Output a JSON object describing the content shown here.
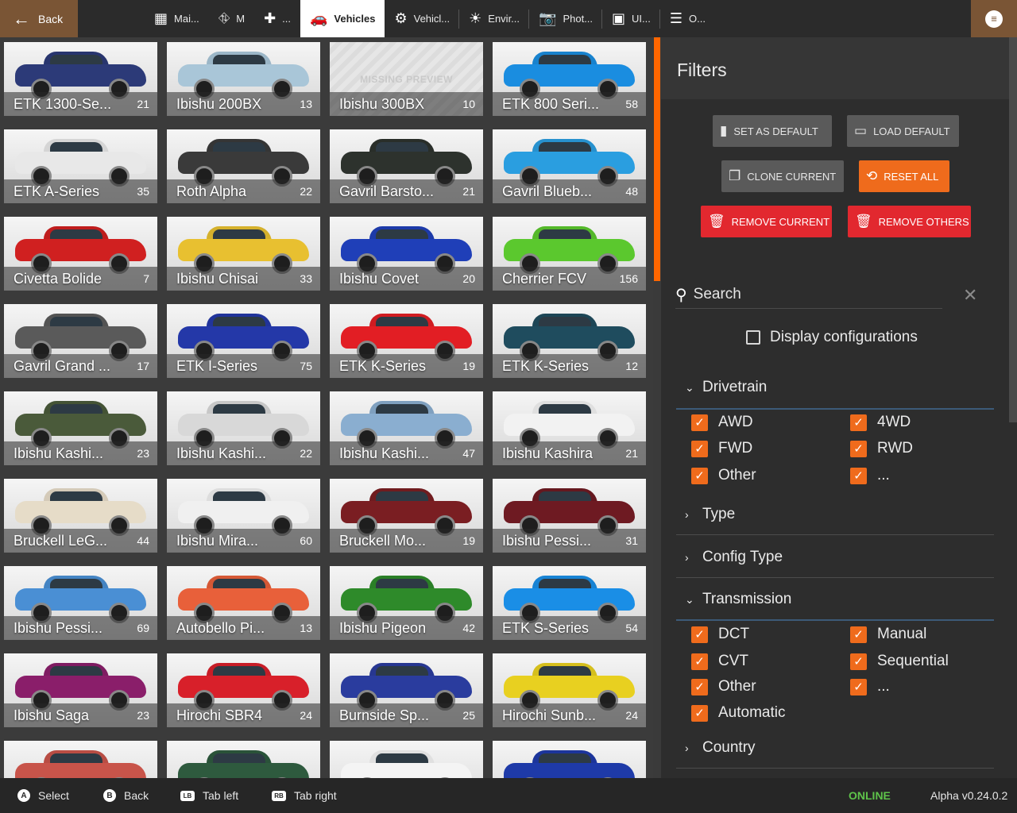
{
  "topbar": {
    "back_label": "Back",
    "tabs": [
      {
        "label": "Mai...",
        "icon": "main-menu-icon",
        "glyph": "▦"
      },
      {
        "label": "M",
        "icon": "map-icon",
        "glyph": "⛗"
      },
      {
        "label": "...",
        "icon": "puzzle-icon",
        "glyph": "✚"
      },
      {
        "label": "Vehicles",
        "icon": "car-icon",
        "glyph": "🚗"
      },
      {
        "label": "Vehicl...",
        "icon": "vehicle-config-icon",
        "glyph": "⚙"
      },
      {
        "label": "Envir...",
        "icon": "weather-icon",
        "glyph": "☀"
      },
      {
        "label": "Phot...",
        "icon": "camera-icon",
        "glyph": "📷"
      },
      {
        "label": "UI...",
        "icon": "ui-apps-icon",
        "glyph": "▣"
      },
      {
        "label": "O...",
        "icon": "sliders-icon",
        "glyph": "☰"
      }
    ]
  },
  "vehicles": [
    {
      "name": "ETK 1300-Se...",
      "count": "21",
      "color": "#2c3a78"
    },
    {
      "name": "Ibishu 200BX",
      "count": "13",
      "color": "#a9c6d8"
    },
    {
      "name": "Ibishu 300BX",
      "count": "10",
      "color": "",
      "missing": "MISSING PREVIEW"
    },
    {
      "name": "ETK 800 Seri...",
      "count": "58",
      "color": "#1a8de0"
    },
    {
      "name": "ETK A-Series",
      "count": "35",
      "color": "#e8e8e8"
    },
    {
      "name": "Roth Alpha",
      "count": "22",
      "color": "#3a3a3a"
    },
    {
      "name": "Gavril Barsto...",
      "count": "21",
      "color": "#2d322d"
    },
    {
      "name": "Gavril Blueb...",
      "count": "48",
      "color": "#2a9ee0"
    },
    {
      "name": "Civetta Bolide",
      "count": "7",
      "color": "#d02020"
    },
    {
      "name": "Ibishu Chisai",
      "count": "33",
      "color": "#e8c030"
    },
    {
      "name": "Ibishu Covet",
      "count": "20",
      "color": "#1f3fb8"
    },
    {
      "name": "Cherrier FCV",
      "count": "156",
      "color": "#5bc82e"
    },
    {
      "name": "Gavril Grand ...",
      "count": "17",
      "color": "#5a5a5a"
    },
    {
      "name": "ETK I-Series",
      "count": "75",
      "color": "#2438a8"
    },
    {
      "name": "ETK K-Series",
      "count": "19",
      "color": "#e21e24"
    },
    {
      "name": "ETK K-Series",
      "count": "12",
      "color": "#1f4c5e"
    },
    {
      "name": "Ibishu Kashi...",
      "count": "23",
      "color": "#4a5a3a"
    },
    {
      "name": "Ibishu Kashi...",
      "count": "22",
      "color": "#d8d8d8"
    },
    {
      "name": "Ibishu Kashi...",
      "count": "47",
      "color": "#8aaed0"
    },
    {
      "name": "Ibishu Kashira",
      "count": "21",
      "color": "#f2f2f2"
    },
    {
      "name": "Bruckell LeG...",
      "count": "44",
      "color": "#e6dcc8"
    },
    {
      "name": "Ibishu Mira...",
      "count": "60",
      "color": "#f0f0f0"
    },
    {
      "name": "Bruckell Mo...",
      "count": "19",
      "color": "#7a1e22"
    },
    {
      "name": "Ibishu Pessi...",
      "count": "31",
      "color": "#6e1a22"
    },
    {
      "name": "Ibishu Pessi...",
      "count": "69",
      "color": "#4a8fd4"
    },
    {
      "name": "Autobello Pi...",
      "count": "13",
      "color": "#e8603a"
    },
    {
      "name": "Ibishu Pigeon",
      "count": "42",
      "color": "#2e8a2a"
    },
    {
      "name": "ETK S-Series",
      "count": "54",
      "color": "#1a8ee6"
    },
    {
      "name": "Ibishu Saga",
      "count": "23",
      "color": "#8a1e6a"
    },
    {
      "name": "Hirochi SBR4",
      "count": "24",
      "color": "#d8202a"
    },
    {
      "name": "Burnside Sp...",
      "count": "25",
      "color": "#2a3c9e"
    },
    {
      "name": "Hirochi Sunb...",
      "count": "24",
      "color": "#e8d020"
    },
    {
      "name": "",
      "count": "",
      "color": "#c8544a"
    },
    {
      "name": "",
      "count": "",
      "color": "#2e5a3e"
    },
    {
      "name": "",
      "count": "",
      "color": "#f4f4f4"
    },
    {
      "name": "",
      "count": "",
      "color": "#1e3aa8"
    }
  ],
  "filters": {
    "title": "Filters",
    "buttons": {
      "set_default": "Set as default",
      "load_default": "Load default",
      "clone_current": "Clone current",
      "reset_all": "Reset all",
      "remove_current": "Remove current",
      "remove_others": "Remove others"
    },
    "search_placeholder": "Search",
    "display_configurations": "Display configurations",
    "drivetrain": {
      "title": "Drivetrain",
      "options": [
        "AWD",
        "4WD",
        "FWD",
        "RWD",
        "Other",
        "..."
      ]
    },
    "type_title": "Type",
    "config_type_title": "Config Type",
    "transmission": {
      "title": "Transmission",
      "options": [
        "DCT",
        "Manual",
        "CVT",
        "Sequential",
        "Other",
        "...",
        "Automatic"
      ]
    },
    "country_title": "Country"
  },
  "bottombar": {
    "select": "Select",
    "back": "Back",
    "tab_left": "Tab left",
    "tab_right": "Tab right",
    "status": "ONLINE",
    "version": "Alpha v0.24.0.2",
    "keys": {
      "a": "A",
      "b": "B",
      "lb": "LB",
      "rb": "RB"
    }
  },
  "colors": {
    "accent": "#ef6b1c",
    "danger": "#e2282f",
    "online": "#5ec34a"
  }
}
